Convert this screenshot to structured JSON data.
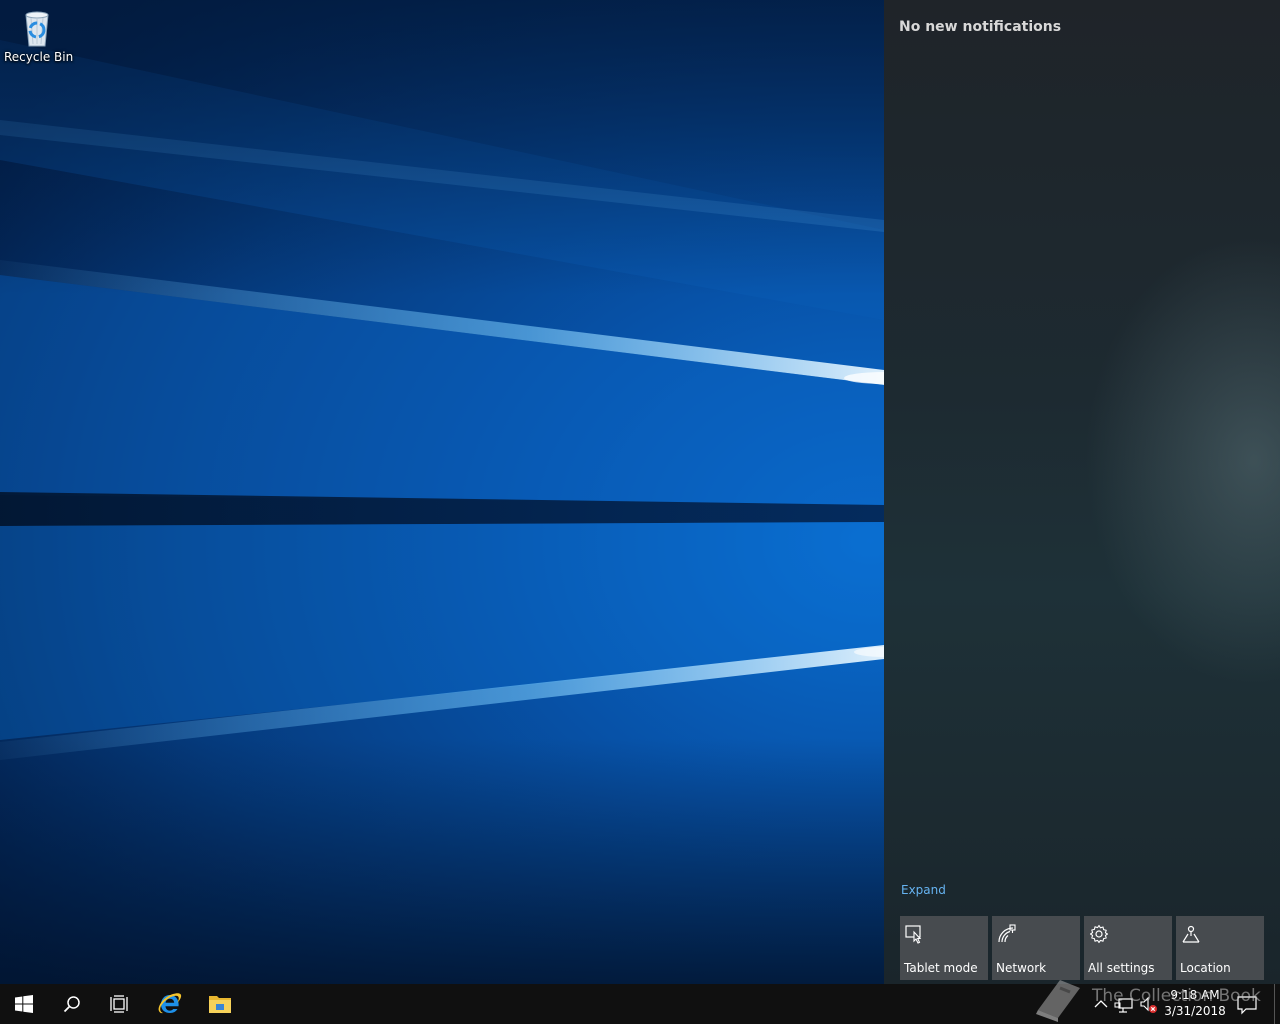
{
  "desktop": {
    "icons": [
      {
        "label": "Recycle Bin",
        "icon": "recycle-bin-icon"
      }
    ]
  },
  "action_center": {
    "heading": "No new notifications",
    "expand_label": "Expand",
    "quick_actions": [
      {
        "label": "Tablet mode",
        "icon": "tablet-mode-icon"
      },
      {
        "label": "Network",
        "icon": "network-icon"
      },
      {
        "label": "All settings",
        "icon": "gear-icon"
      },
      {
        "label": "Location",
        "icon": "location-icon"
      }
    ]
  },
  "taskbar": {
    "buttons": [
      {
        "name": "start",
        "icon": "windows-logo-icon"
      },
      {
        "name": "search",
        "icon": "search-icon"
      },
      {
        "name": "task-view",
        "icon": "task-view-icon"
      },
      {
        "name": "internet-explorer",
        "icon": "internet-explorer-icon"
      },
      {
        "name": "file-explorer",
        "icon": "folder-icon"
      }
    ],
    "tray": {
      "time": "9:18 AM",
      "date": "3/31/2018",
      "icons": [
        "chevron-up-icon",
        "network-wired-icon",
        "volume-muted-icon",
        "action-center-icon"
      ]
    }
  },
  "watermark": {
    "text": "The Collection Book",
    "icon": "book-icon"
  },
  "colors": {
    "taskbar": "#101010",
    "action_center_bg": "#1e2a30",
    "tile_bg": "#474b4f",
    "link": "#66b3f0",
    "wallpaper_glow": "#4fb4ff"
  }
}
